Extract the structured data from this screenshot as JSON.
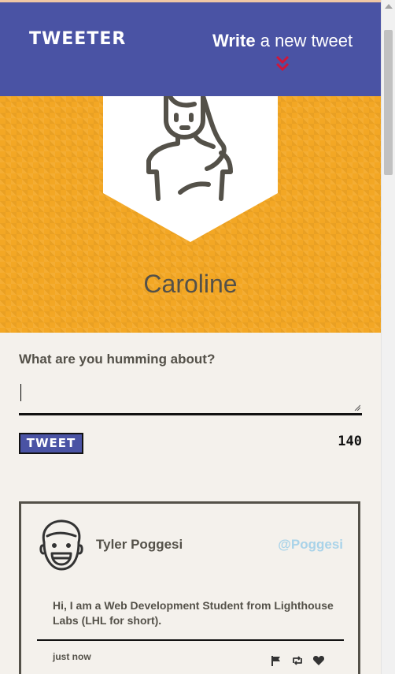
{
  "nav": {
    "brand": "TWEETER",
    "compose_bold": "Write",
    "compose_rest": " a new tweet",
    "accent_color": "#4a53a4",
    "chevron_icon": "double-chevron-down-icon",
    "chevron_color": "#d0163a"
  },
  "profile": {
    "name": "Caroline",
    "background_color": "#f3a724",
    "avatar_icon": "user-avatar-icon"
  },
  "compose": {
    "prompt": "What are you humming about?",
    "textarea_value": "",
    "submit_label": "TWEET",
    "char_counter": "140"
  },
  "tweets": [
    {
      "author": "Tyler Poggesi",
      "handle": "@Poggesi",
      "avatar_icon": "smiling-face-avatar-icon",
      "text": "Hi, I am a Web Development Student from Lighthouse Labs (LHL for short).",
      "timestamp": "just now",
      "actions": [
        "flag-icon",
        "retweet-icon",
        "heart-icon"
      ],
      "handle_color": "#a9d3e9"
    }
  ]
}
